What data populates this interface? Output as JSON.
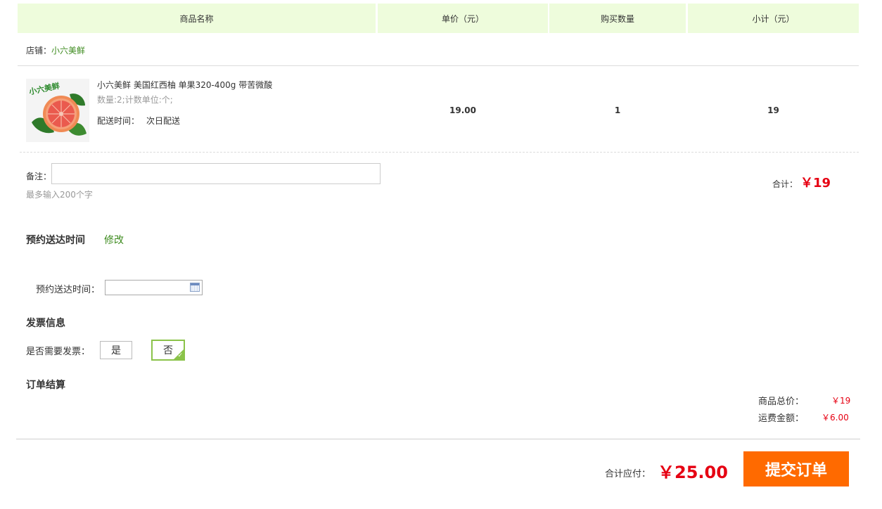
{
  "table_header": {
    "col_name": "商品名称",
    "col_unit_price": "单价（元）",
    "col_quantity": "购买数量",
    "col_subtotal": "小计（元）"
  },
  "shop": {
    "label": "店铺：",
    "name": "小六美鲜"
  },
  "product": {
    "image_text": "小六美鲜",
    "name": "小六美鲜 美国红西柚 单果320-400g 带苦微酸",
    "spec": "数量:2;计数单位:个;",
    "delivery_label": "配送时间：",
    "delivery_value": "次日配送",
    "unit_price": "19.00",
    "quantity": "1",
    "subtotal": "19"
  },
  "note": {
    "label": "备注：",
    "placeholder": "",
    "hint": "最多输入200个字"
  },
  "total": {
    "label": "合计：",
    "value": "￥19"
  },
  "schedule": {
    "title": "预约送达时间",
    "edit": "修改",
    "field_label": "预约送达时间：",
    "field_value": ""
  },
  "invoice": {
    "title": "发票信息",
    "question": "是否需要发票：",
    "option_yes": "是",
    "option_no": "否",
    "selected": "否"
  },
  "settlement": {
    "title": "订单结算",
    "goods_total_label": "商品总价：",
    "goods_total_value": "￥19",
    "shipping_label": "运费金额：",
    "shipping_value": "￥6.00"
  },
  "footer": {
    "pay_label": "合计应付：",
    "pay_value": "￥25.00",
    "submit_label": "提交订单"
  },
  "colors": {
    "header_bg": "#eefcdc",
    "accent_green": "#3d8b1e",
    "price_red": "#e60012",
    "submit_orange": "#ff6a00",
    "selected_border": "#8bc34a"
  }
}
